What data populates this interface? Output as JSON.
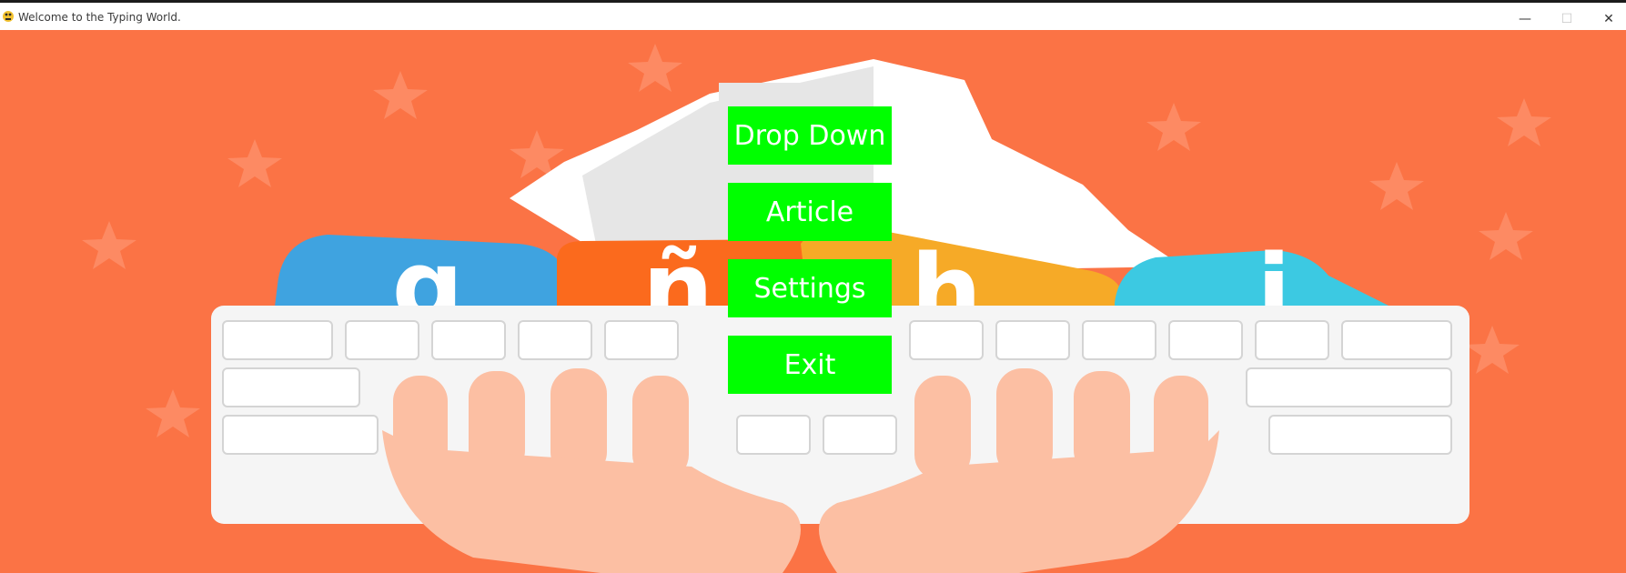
{
  "window": {
    "title": "Welcome to the Typing World.",
    "controls": {
      "minimize": "—",
      "maximize": "☐",
      "close": "✕"
    }
  },
  "background": {
    "keycaps": [
      "g",
      "ñ",
      "h",
      "i"
    ],
    "colors": {
      "canvas": "#fb7345",
      "button": "#00ff00",
      "button_text": "#ffffff"
    }
  },
  "menu": {
    "items": [
      {
        "label": "Drop Down"
      },
      {
        "label": "Article"
      },
      {
        "label": "Settings"
      },
      {
        "label": "Exit"
      }
    ]
  }
}
